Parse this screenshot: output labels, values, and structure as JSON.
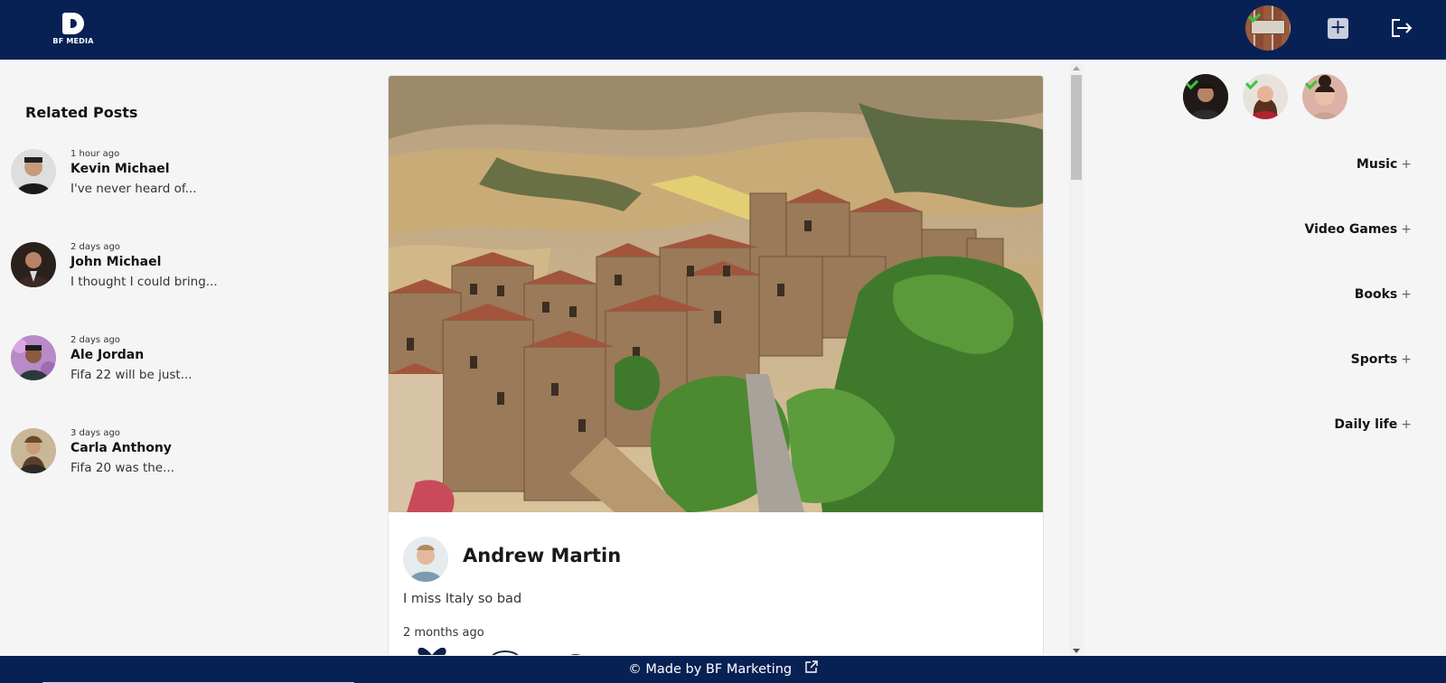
{
  "header": {
    "logo_text": "BF MEDIA",
    "add_label": "+",
    "accent_color": "#082154"
  },
  "sidebar": {
    "title": "Related Posts",
    "posts": [
      {
        "time": "1 hour ago",
        "name": "Kevin Michael",
        "excerpt": "I've never heard of..."
      },
      {
        "time": "2 days ago",
        "name": "John Michael",
        "excerpt": "I thought I could bring..."
      },
      {
        "time": "2 days ago",
        "name": "Ale Jordan",
        "excerpt": "Fifa 22 will be just..."
      },
      {
        "time": "3 days ago",
        "name": "Carla Anthony",
        "excerpt": "Fifa 20 was the..."
      }
    ]
  },
  "post": {
    "author": "Andrew Martin",
    "text": "I miss Italy so bad",
    "time": "2 months ago",
    "icons": [
      "heart-icon",
      "comment-icon",
      "share-icon"
    ]
  },
  "categories": [
    {
      "label": "Music",
      "plus": "+"
    },
    {
      "label": "Video Games",
      "plus": "+"
    },
    {
      "label": "Books",
      "plus": "+"
    },
    {
      "label": "Sports",
      "plus": "+"
    },
    {
      "label": "Daily life",
      "plus": "+"
    }
  ],
  "footer": {
    "text": "© Made by BF Marketing"
  }
}
